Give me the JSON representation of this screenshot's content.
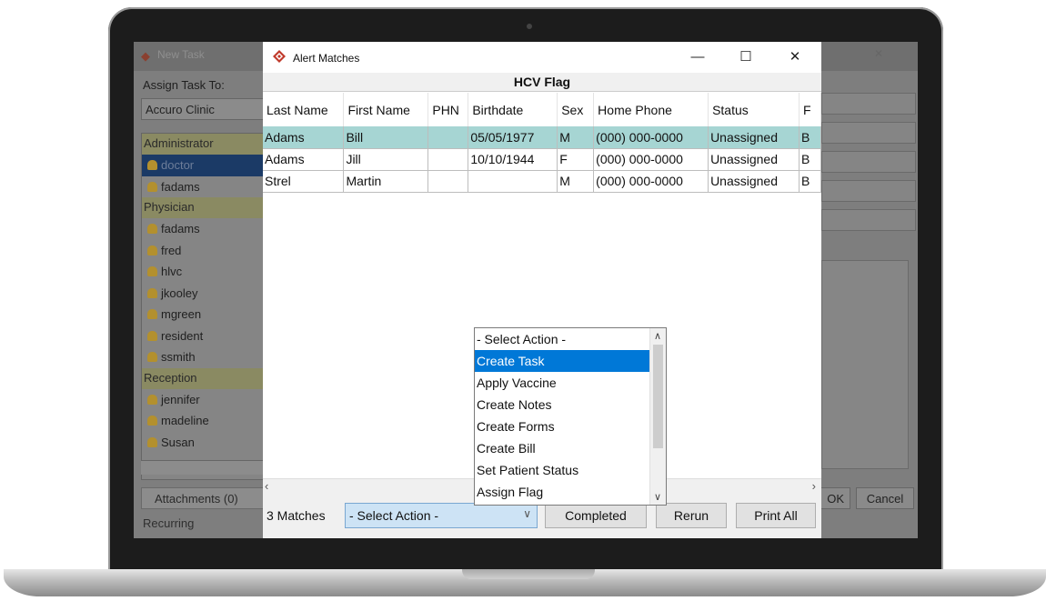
{
  "background_app": {
    "title": "New Task",
    "assign_task_to_label": "Assign Task To:",
    "clinic": "Accuro Clinic",
    "groups": [
      {
        "name": "Administrator",
        "users": [
          "doctor",
          "fadams"
        ]
      },
      {
        "name": "Physician",
        "users": [
          "fadams",
          "fred",
          "hlvc",
          "jkooley",
          "mgreen",
          "resident",
          "ssmith"
        ]
      },
      {
        "name": "Reception",
        "users": [
          "jennifer",
          "madeline",
          "Susan"
        ]
      }
    ],
    "selected_user": "doctor",
    "attachments_label": "Attachments (0)",
    "recurring_label": "Recurring",
    "ok_label": "OK",
    "cancel_label": "Cancel",
    "window_buttons": "— ◻ ✕"
  },
  "dialog": {
    "title": "Alert Matches",
    "window_buttons": {
      "minimize": "—",
      "maximize": "☐",
      "close": "✕"
    },
    "table_title": "HCV Flag",
    "columns": [
      "Last Name",
      "First Name",
      "PHN",
      "Birthdate",
      "Sex",
      "Home Phone",
      "Status",
      "F"
    ],
    "rows": [
      [
        "Adams",
        "Bill",
        "",
        "05/05/1977",
        "M",
        "(000) 000-0000",
        "Unassigned",
        "B"
      ],
      [
        "Adams",
        "Jill",
        "",
        "10/10/1944",
        "F",
        "(000) 000-0000",
        "Unassigned",
        "B"
      ],
      [
        "Strel",
        "Martin",
        "",
        "",
        "M",
        "(000) 000-0000",
        "Unassigned",
        "B"
      ]
    ],
    "selected_row": 0,
    "matches_label": "3 Matches",
    "action_select_value": "- Select Action -",
    "action_options": [
      "- Select Action -",
      "Create Task",
      "Apply Vaccine",
      "Create Notes",
      "Create Forms",
      "Create Bill",
      "Set Patient Status",
      "Assign Flag"
    ],
    "highlighted_option": "Create Task",
    "buttons": {
      "completed": "Completed",
      "rerun": "Rerun",
      "print_all": "Print All"
    },
    "selected_row_color": "#a6d5d3",
    "highlight_color": "#0078d7"
  }
}
